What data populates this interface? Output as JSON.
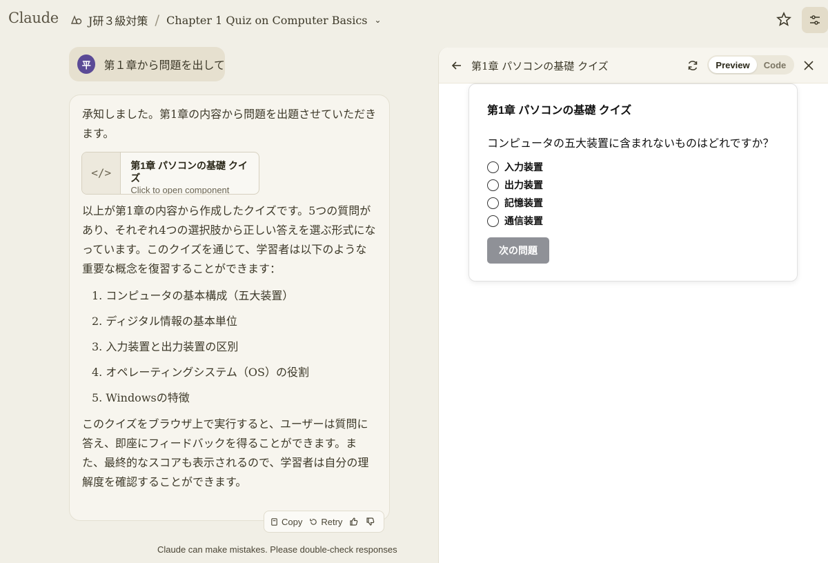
{
  "header": {
    "logo": "Claude",
    "project": "J研３級対策",
    "separator": "/",
    "chat_title": "Chapter 1 Quiz on Computer Basics"
  },
  "user_message": {
    "avatar_initial": "平",
    "text": "第１章から問題を出して"
  },
  "assistant": {
    "intro": "承知しました。第1章の内容から問題を出題させていただきます。",
    "artifact": {
      "title": "第1章 パソコンの基礎 クイズ",
      "subtitle": "Click to open component",
      "icon_text": "</>"
    },
    "para1": "以上が第1章の内容から作成したクイズです。5つの質問があり、それぞれ4つの選択肢から正しい答えを選ぶ形式になっています。このクイズを通じて、学習者は以下のような重要な概念を復習することができます：",
    "list": [
      "1. コンピュータの基本構成（五大装置）",
      "2. ディジタル情報の基本単位",
      "3. 入力装置と出力装置の区別",
      "4. オペレーティングシステム（OS）の役割",
      "5. Windowsの特徴"
    ],
    "para2": "このクイズをブラウザ上で実行すると、ユーザーは質問に答え、即座にフィードバックを得ることができます。また、最終的なスコアも表示されるので、学習者は自分の理解度を確認することができます。"
  },
  "actions": {
    "copy": "Copy",
    "retry": "Retry"
  },
  "disclaimer": "Claude can make mistakes. Please double-check responses",
  "panel": {
    "title": "第1章 パソコンの基礎 クイズ",
    "preview_label": "Preview",
    "code_label": "Code",
    "quiz": {
      "title": "第1章 パソコンの基礎 クイズ",
      "question": "コンピュータの五大装置に含まれないものはどれですか？",
      "options": [
        "入力装置",
        "出力装置",
        "記憶装置",
        "通信装置"
      ],
      "next_label": "次の問題"
    }
  },
  "icons": {
    "project": "project-icon",
    "star": "star-icon",
    "settings": "settings-sliders-icon",
    "back": "arrow-left-icon",
    "refresh": "refresh-icon",
    "close": "close-icon",
    "copy": "copy-icon",
    "retry": "retry-icon",
    "thumbs_up": "thumbs-up-icon",
    "thumbs_down": "thumbs-down-icon"
  }
}
